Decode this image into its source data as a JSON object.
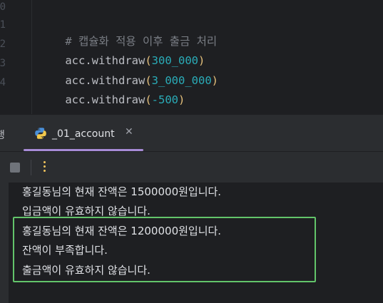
{
  "editor": {
    "gutter_numbers": [
      "0",
      "1",
      "2",
      "3",
      "4"
    ],
    "comment": "# 캡슐화 적용 이후 출금 처리",
    "lines": [
      {
        "obj": "acc",
        "method": ".withdraw",
        "open": "(",
        "arg": "300_000",
        "close": ")"
      },
      {
        "obj": "acc",
        "method": ".withdraw",
        "open": "(",
        "arg": "3_000_000",
        "close": ")"
      },
      {
        "obj": "acc",
        "method": ".withdraw",
        "open": "(",
        "arg": "-500",
        "close": ")"
      }
    ]
  },
  "run_panel": {
    "edge_label": "행",
    "tab_label": "_01_account",
    "close_glyph": "✕"
  },
  "console": {
    "lines": [
      "홍길동님의 현재 잔액은 1500000원입니다.",
      "입금액이 유효하지 않습니다.",
      "홍길동님의 현재 잔액은 1200000원입니다.",
      "잔액이 부족합니다.",
      "출금액이 유효하지 않습니다."
    ]
  },
  "colors": {
    "highlight_border": "#62c46a",
    "tab_underline": "#a78bd6",
    "number_token": "#2aacb8",
    "paren_token": "#e5c07b"
  },
  "icons": {
    "tab_icon": "python-icon",
    "stop": "stop-icon",
    "more": "more-vertical-icon",
    "close": "close-icon"
  }
}
